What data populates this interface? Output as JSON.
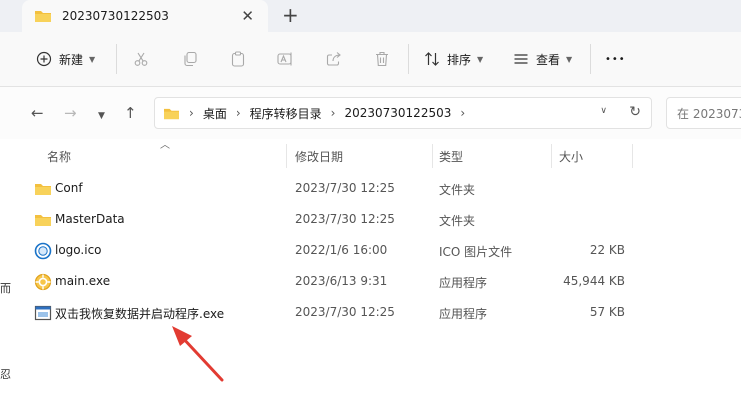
{
  "tab": {
    "title": "20230730122503",
    "close": "✕",
    "new": "+"
  },
  "toolbar": {
    "new_label": "新建",
    "sort_label": "排序",
    "view_label": "查看",
    "more": "•••"
  },
  "address": {
    "crumbs": [
      "桌面",
      "程序转移目录",
      "20230730122503"
    ],
    "search_placeholder": "在 2023073"
  },
  "columns": {
    "name": "名称",
    "date": "修改日期",
    "type": "类型",
    "size": "大小"
  },
  "files": [
    {
      "name": "Conf",
      "date": "2023/7/30 12:25",
      "type": "文件夹",
      "size": "",
      "icon": "folder-icon"
    },
    {
      "name": "MasterData",
      "date": "2023/7/30 12:25",
      "type": "文件夹",
      "size": "",
      "icon": "folder-icon"
    },
    {
      "name": "logo.ico",
      "date": "2022/1/6 16:00",
      "type": "ICO 图片文件",
      "size": "22 KB",
      "icon": "ico-file-icon"
    },
    {
      "name": "main.exe",
      "date": "2023/6/13 9:31",
      "type": "应用程序",
      "size": "45,944 KB",
      "icon": "app-icon"
    },
    {
      "name": "双击我恢复数据并启动程序.exe",
      "date": "2023/7/30 12:25",
      "type": "应用程序",
      "size": "57 KB",
      "icon": "window-app-icon"
    }
  ],
  "left_edge": [
    "而",
    "忍"
  ],
  "colors": {
    "folder": "#f3c03f",
    "accent": "#1a73c8",
    "annotation_arrow": "#e23b32"
  }
}
